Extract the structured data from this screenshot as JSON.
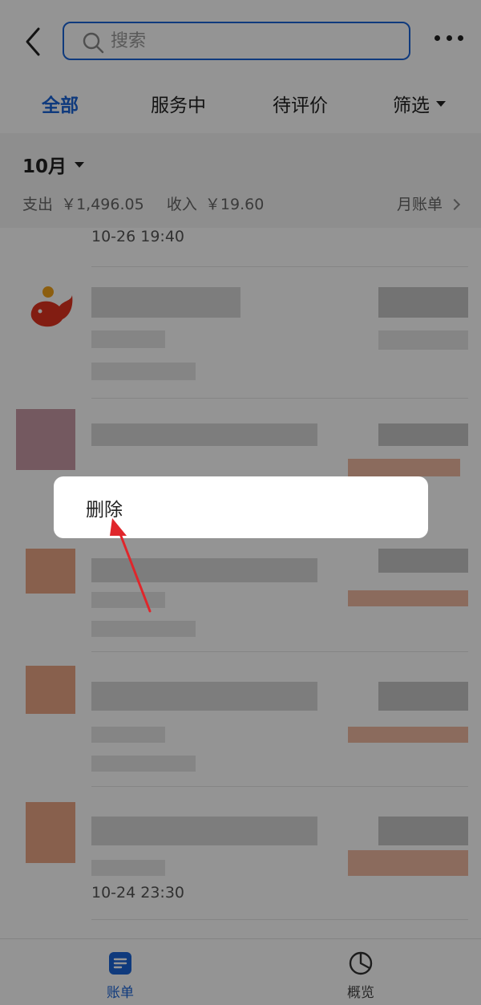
{
  "header": {
    "search_placeholder": "搜索",
    "back_icon": "chevron-left-icon",
    "more_icon": "more-dots-icon"
  },
  "tabs": [
    {
      "label": "全部",
      "active": true
    },
    {
      "label": "服务中",
      "active": false
    },
    {
      "label": "待评价",
      "active": false
    },
    {
      "label": "筛选",
      "active": false
    }
  ],
  "month": {
    "label": "10月",
    "expense_label": "支出",
    "expense_value": "￥1,496.05",
    "income_label": "收入",
    "income_value": "￥19.60",
    "bill_link": "月账单"
  },
  "list": {
    "first_date": "10-26 19:40",
    "last_date": "10-24 23:30"
  },
  "context_menu": {
    "delete_label": "删除"
  },
  "bottom_nav": {
    "bills_label": "账单",
    "overview_label": "概览"
  },
  "colors": {
    "accent": "#1a64d8",
    "annotation_arrow": "#e0262b"
  }
}
